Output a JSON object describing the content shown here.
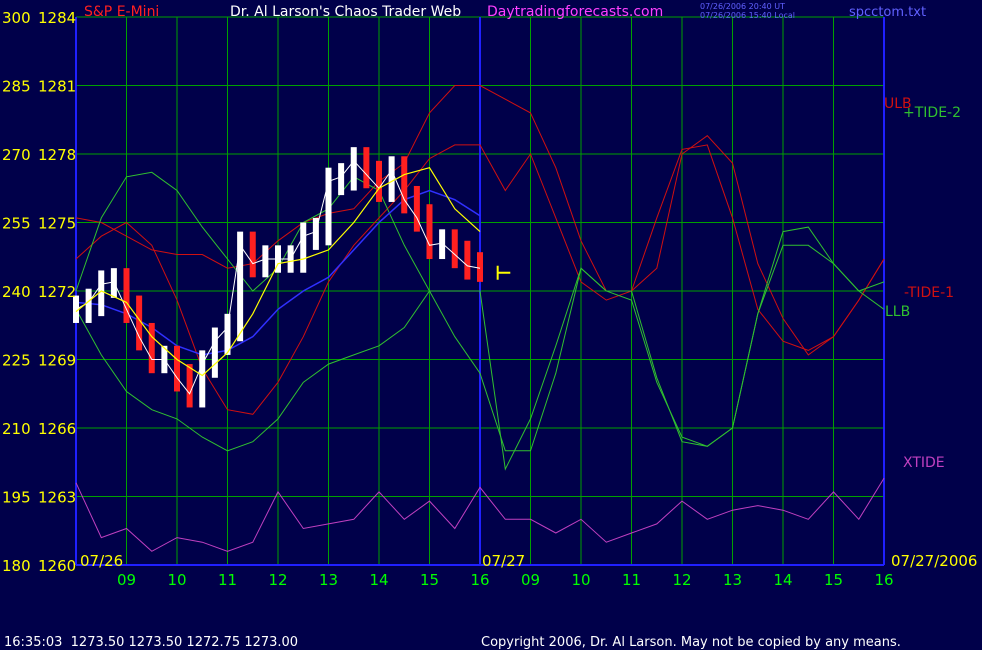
{
  "header": {
    "symbol": "S&P E-Mini",
    "title": "Dr. Al Larson's Chaos Trader Web",
    "site": "Daytradingforecasts.com",
    "time_ut": "07/26/2006 20:40 UT",
    "time_local": "07/26/2006 15:40 Local",
    "file": "spcctom.txt"
  },
  "footer": {
    "quote": "16:35:03  1273.50 1273.50 1272.75 1273.00",
    "copyright": "Copyright 2006, Dr. Al Larson. May not be copied by any means."
  },
  "colors": {
    "background": "#00004a",
    "grid": "#00a000",
    "axis": "#2020ff",
    "price_up": "#ffffff",
    "price_down": "#ff2020",
    "yellow": "#ffff00",
    "ulb": "#d01010",
    "llb": "#30c030",
    "xtide": "#c040c0",
    "time_labels": "#00ff00",
    "site": "#ff40ff",
    "file_label": "#6060ff"
  },
  "chart_data": {
    "type": "line",
    "y_left_labels": [
      "300",
      "285",
      "270",
      "255",
      "240",
      "225",
      "210",
      "195",
      "180"
    ],
    "y_right_labels": [
      "1284",
      "1281",
      "1278",
      "1275",
      "1272",
      "1269",
      "1266",
      "1263",
      "1260"
    ],
    "ylim_left": [
      180,
      300
    ],
    "ylim_price": [
      1260,
      1284
    ],
    "x_ticks": [
      "09",
      "10",
      "11",
      "12",
      "13",
      "14",
      "15",
      "16",
      "09",
      "10",
      "11",
      "12",
      "13",
      "14",
      "15",
      "16"
    ],
    "date_labels": [
      "07/26",
      "07/27",
      "07/27/2006"
    ],
    "series_labels": [
      "ULB",
      "+TIDE-2",
      "-TIDE-1",
      "LLB",
      "XTIDE"
    ],
    "series": [
      {
        "name": "ULB",
        "x": [
          0,
          0.5,
          1,
          1.5,
          2,
          2.5,
          3,
          3.5,
          4,
          4.5,
          5,
          5.5,
          6,
          6.5,
          7,
          7.5,
          8,
          8.5,
          9,
          9.5,
          10,
          10.5,
          11,
          11.5,
          12,
          12.5,
          13,
          13.5,
          14,
          14.5,
          15,
          15.5,
          16
        ],
        "values": [
          256,
          255,
          252,
          249,
          248,
          248,
          245,
          246,
          251,
          255,
          257,
          258,
          264,
          268,
          279,
          285,
          285,
          282,
          279,
          267,
          251,
          240,
          240,
          245,
          270,
          274,
          268,
          246,
          234,
          226,
          230,
          238,
          247
        ]
      },
      {
        "name": "-TIDE-1",
        "x": [
          0,
          0.5,
          1,
          1.5,
          2,
          2.5,
          3,
          3.5,
          4,
          4.5,
          5,
          5.5,
          6,
          6.5,
          7,
          7.5,
          8,
          8.5,
          9,
          9.5,
          10,
          10.5,
          11,
          11.5,
          12,
          12.5,
          13,
          13.5,
          14,
          14.5,
          15,
          15.5,
          16
        ],
        "values": [
          247,
          252,
          255,
          250,
          238,
          223,
          214,
          213,
          220,
          230,
          242,
          250,
          256,
          262,
          269,
          272,
          272,
          262,
          270,
          256,
          242,
          238,
          240,
          256,
          271,
          272,
          256,
          236,
          229,
          227,
          230,
          238,
          247
        ]
      },
      {
        "name": "LLB",
        "x": [
          0,
          0.5,
          1,
          1.5,
          2,
          2.5,
          3,
          3.5,
          4,
          4.5,
          5,
          5.5,
          6,
          6.5,
          7,
          7.5,
          8,
          8.5,
          9,
          9.5,
          10,
          10.5,
          11,
          11.5,
          12,
          12.5,
          13,
          13.5,
          14,
          14.5,
          15,
          15.5,
          16
        ],
        "values": [
          236,
          226,
          218,
          214,
          212,
          208,
          205,
          207,
          212,
          220,
          224,
          226,
          228,
          232,
          240,
          240,
          240,
          201,
          212,
          228,
          245,
          240,
          238,
          220,
          208,
          206,
          210,
          235,
          250,
          250,
          246,
          240,
          236
        ]
      },
      {
        "name": "+TIDE-2",
        "x": [
          0,
          0.5,
          1,
          1.5,
          2,
          2.5,
          3,
          3.5,
          4,
          4.5,
          5,
          5.5,
          6,
          6.5,
          7,
          7.5,
          8,
          8.5,
          9,
          9.5,
          10,
          10.5,
          11,
          11.5,
          12,
          12.5,
          13,
          13.5,
          14,
          14.5,
          15,
          15.5,
          16
        ],
        "values": [
          240,
          256,
          265,
          266,
          262,
          254,
          247,
          240,
          245,
          255,
          258,
          265,
          262,
          250,
          240,
          230,
          222,
          205,
          205,
          222,
          245,
          240,
          240,
          221,
          207,
          206,
          210,
          235,
          253,
          254,
          246,
          240,
          242
        ]
      },
      {
        "name": "XTIDE",
        "x": [
          0,
          0.5,
          1,
          1.5,
          2,
          2.5,
          3,
          3.5,
          4,
          4.5,
          5,
          5.5,
          6,
          6.5,
          7,
          7.5,
          8,
          8.5,
          9,
          9.5,
          10,
          10.5,
          11,
          11.5,
          12,
          12.5,
          13,
          13.5,
          14,
          14.5,
          15,
          15.5,
          16
        ],
        "values": [
          198,
          186,
          188,
          183,
          186,
          185,
          183,
          185,
          196,
          188,
          189,
          190,
          196,
          190,
          194,
          188,
          197,
          190,
          190,
          187,
          190,
          185,
          187,
          189,
          194,
          190,
          192,
          193,
          192,
          190,
          196,
          190,
          199
        ]
      },
      {
        "name": "S&P E-Mini",
        "x": [
          0,
          0.25,
          0.5,
          0.75,
          1,
          1.25,
          1.5,
          1.75,
          2,
          2.25,
          2.5,
          2.75,
          3,
          3.25,
          3.5,
          3.75,
          4,
          4.25,
          4.5,
          4.75,
          5,
          5.25,
          5.5,
          5.75,
          6,
          6.25,
          6.5,
          6.75,
          7,
          7.25,
          7.5,
          7.75,
          8
        ],
        "values": [
          1271.2,
          1271.5,
          1272.3,
          1272.4,
          1271.2,
          1270.0,
          1269.0,
          1269.0,
          1268.2,
          1267.5,
          1268.8,
          1269.8,
          1270.4,
          1274.0,
          1273.2,
          1273.4,
          1273.4,
          1273.4,
          1274.4,
          1274.6,
          1276.8,
          1277.0,
          1277.7,
          1277.1,
          1276.5,
          1277.3,
          1276.0,
          1275.2,
          1274.0,
          1274.1,
          1273.6,
          1273.1,
          1273.0
        ]
      },
      {
        "name": "yellow-average",
        "x": [
          0,
          0.5,
          1,
          1.5,
          2,
          2.5,
          3,
          3.5,
          4,
          4.5,
          5,
          5.5,
          6,
          6.5,
          7,
          7.5,
          8
        ],
        "values": [
          1271.1,
          1272.0,
          1271.5,
          1270.0,
          1269.0,
          1268.3,
          1269.3,
          1271.0,
          1273.2,
          1273.4,
          1273.8,
          1275.0,
          1276.5,
          1277.1,
          1277.4,
          1275.6,
          1274.6
        ]
      },
      {
        "name": "blue-average",
        "x": [
          0,
          0.5,
          1,
          1.5,
          2,
          2.5,
          3,
          3.5,
          4,
          4.5,
          5,
          5.5,
          6,
          6.5,
          7,
          7.5,
          8
        ],
        "values": [
          1271.5,
          1271.4,
          1271.0,
          1270.4,
          1269.6,
          1269.2,
          1269.4,
          1270.0,
          1271.2,
          1272.0,
          1272.6,
          1273.8,
          1275.0,
          1276.0,
          1276.4,
          1276.0,
          1275.3
        ]
      }
    ],
    "forecast_marker_price": 1272.8,
    "grid": true
  }
}
